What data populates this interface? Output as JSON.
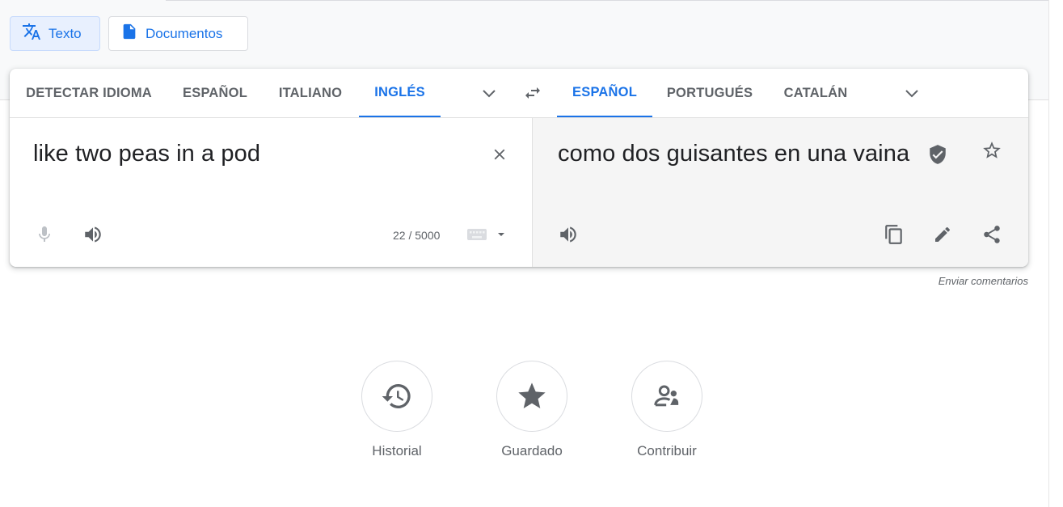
{
  "modes": {
    "text_label": "Texto",
    "docs_label": "Documentos"
  },
  "source_langs": [
    "DETECTAR IDIOMA",
    "ESPAÑOL",
    "ITALIANO",
    "INGLÉS"
  ],
  "target_langs": [
    "ESPAÑOL",
    "PORTUGUÉS",
    "CATALÁN"
  ],
  "source": {
    "text": "like two peas in a pod",
    "char_count": "22 / 5000"
  },
  "target": {
    "text": "como dos guisantes en una vaina"
  },
  "feedback_label": "Enviar comentarios",
  "quick_links": [
    "Historial",
    "Guardado",
    "Contribuir"
  ],
  "colors": {
    "accent": "#1a73e8",
    "icon_gray": "#5f6368"
  },
  "icons": [
    "translate-icon",
    "document-icon",
    "chevron-down-icon",
    "swap-icon",
    "close-icon",
    "mic-icon",
    "speaker-icon",
    "keyboard-icon",
    "dropdown-arrow-icon",
    "verified-shield-icon",
    "star-outline-icon",
    "copy-icon",
    "pencil-icon",
    "share-icon",
    "history-icon",
    "star-icon",
    "contribute-icon"
  ]
}
